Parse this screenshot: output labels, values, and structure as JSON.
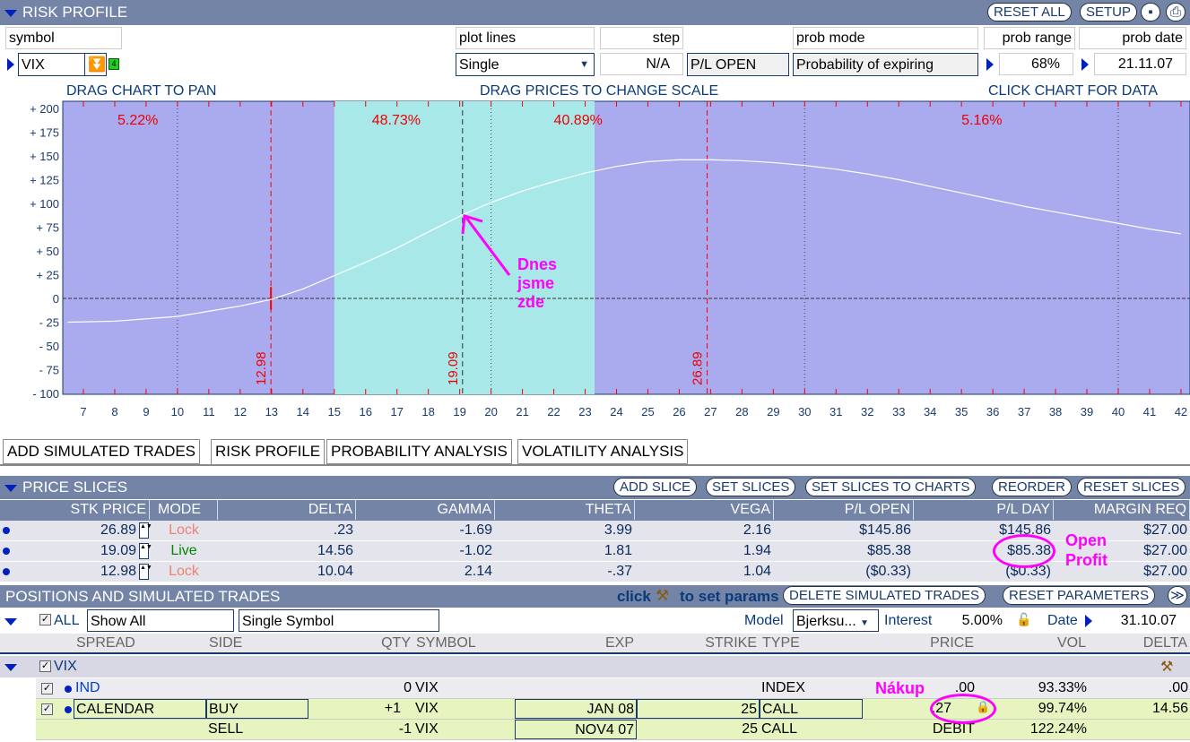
{
  "header": {
    "title": "RISK PROFILE",
    "reset_all": "RESET ALL",
    "setup": "SETUP"
  },
  "controls": {
    "symbol_label": "symbol",
    "symbol_value": "VIX",
    "symbol_badge": "4",
    "plot_lines_label": "plot lines",
    "plot_lines_value": "Single",
    "step_label": "step",
    "step_value": "N/A",
    "pl_mode": "P/L OPEN",
    "prob_mode_label": "prob mode",
    "prob_mode_value": "Probability of expiring",
    "prob_range_label": "prob range",
    "prob_range_value": "68%",
    "prob_date_label": "prob date",
    "prob_date_value": "21.11.07"
  },
  "hints": {
    "pan": "DRAG CHART TO PAN",
    "scale": "DRAG PRICES TO CHANGE SCALE",
    "click": "CLICK CHART FOR DATA"
  },
  "chart_data": {
    "type": "line",
    "xlim": [
      6.3,
      42.2
    ],
    "ylim": [
      -108,
      210
    ],
    "x_ticks": [
      7,
      8,
      9,
      10,
      11,
      12,
      13,
      14,
      15,
      16,
      17,
      18,
      19,
      20,
      21,
      22,
      23,
      24,
      25,
      26,
      27,
      28,
      29,
      30,
      31,
      32,
      33,
      34,
      35,
      36,
      37,
      38,
      39,
      40,
      41,
      42
    ],
    "y_ticks": [
      "+ 200",
      "+ 175",
      "+ 150",
      "+ 125",
      "+ 100",
      "+ 75",
      "+ 50",
      "+ 25",
      "0",
      "- 25",
      "- 50",
      "- 75",
      "- 100"
    ],
    "y_values": [
      200,
      175,
      150,
      125,
      100,
      75,
      50,
      25,
      0,
      -25,
      -50,
      -75,
      -100
    ],
    "x": [
      6.5,
      8,
      10,
      12,
      13,
      14,
      15,
      16,
      17,
      18,
      19.09,
      20,
      21,
      22,
      23,
      24,
      25,
      26,
      27,
      28,
      29,
      30,
      31,
      32,
      33,
      34,
      35,
      36,
      37,
      38,
      39,
      40,
      41,
      42
    ],
    "y": [
      -25,
      -24,
      -19,
      -8,
      -1,
      10,
      24,
      38,
      53,
      70,
      88,
      101,
      113,
      123,
      132,
      139,
      144,
      146,
      146,
      145,
      143,
      140,
      136,
      131,
      125,
      118,
      111,
      104,
      97,
      91,
      85,
      79,
      73,
      68
    ],
    "prob_range": [
      15,
      23.3
    ],
    "price_slices": [
      {
        "value": 12.98,
        "label": "12.98"
      },
      {
        "value": 19.09,
        "label": "19.09"
      },
      {
        "value": 26.89,
        "label": "26.89"
      }
    ],
    "prob_labels": [
      {
        "x": 8,
        "text": "5.22%"
      },
      {
        "x": 16,
        "text": "48.73%"
      },
      {
        "x": 22,
        "text": "40.89%"
      },
      {
        "x": 35,
        "text": "5.16%"
      }
    ],
    "colors": {
      "background": "#aaaaee",
      "prob_band": "#a8e8e8",
      "curve": "#ffffff",
      "slice_line": "#ff0000"
    }
  },
  "tabs": [
    "ADD SIMULATED TRADES",
    "RISK PROFILE",
    "PROBABILITY ANALYSIS",
    "VOLATILITY ANALYSIS"
  ],
  "slices": {
    "title": "PRICE SLICES",
    "buttons": [
      "ADD SLICE",
      "SET SLICES",
      "SET SLICES TO CHARTS",
      "REORDER",
      "RESET SLICES"
    ],
    "columns": [
      "STK PRICE",
      "MODE",
      "DELTA",
      "GAMMA",
      "THETA",
      "VEGA",
      "P/L OPEN",
      "P/L DAY",
      "MARGIN REQ"
    ],
    "rows": [
      [
        "26.89",
        "Lock",
        ".23",
        "-1.69",
        "3.99",
        "2.16",
        "$145.86",
        "$145.86",
        "$27.00"
      ],
      [
        "19.09",
        "Live",
        "14.56",
        "-1.02",
        "1.81",
        "1.94",
        "$85.38",
        "$85.38",
        "$27.00"
      ],
      [
        "12.98",
        "Lock",
        "10.04",
        "2.14",
        "-.37",
        "1.04",
        "($0.33)",
        "($0.33)",
        "$27.00"
      ]
    ]
  },
  "positions": {
    "title": "POSITIONS AND SIMULATED TRADES",
    "click": "click",
    "to_set": "to set params",
    "delete": "DELETE SIMULATED TRADES",
    "reset": "RESET PARAMETERS",
    "all": "ALL",
    "show": "Show All",
    "symbol_mode": "Single Symbol",
    "model_label": "Model",
    "model": "Bjerksu...",
    "interest_label": "Interest",
    "interest": "5.00%",
    "date_label": "Date",
    "date": "31.10.07",
    "columns": [
      "SPREAD",
      "SIDE",
      "QTY",
      "SYMBOL",
      "EXP",
      "STRIKE",
      "TYPE",
      "PRICE",
      "VOL",
      "DELTA"
    ],
    "group": "VIX",
    "rows": [
      [
        "IND",
        "",
        "0",
        "VIX",
        "",
        "",
        "INDEX",
        ".00",
        "93.33%",
        ".00"
      ],
      [
        "CALENDAR",
        "BUY",
        "+1",
        "VIX",
        "JAN 08",
        "25",
        "CALL",
        ".27",
        "99.74%",
        "14.56"
      ],
      [
        "",
        "SELL",
        "-1",
        "VIX",
        "NOV4 07",
        "25",
        "CALL",
        "DEBIT",
        "122.24%",
        ""
      ]
    ]
  },
  "annotations": {
    "today": [
      "Dnes",
      "jsme",
      "zde"
    ],
    "open": "Open",
    "profit": "Profit",
    "buy": "Nákup"
  }
}
